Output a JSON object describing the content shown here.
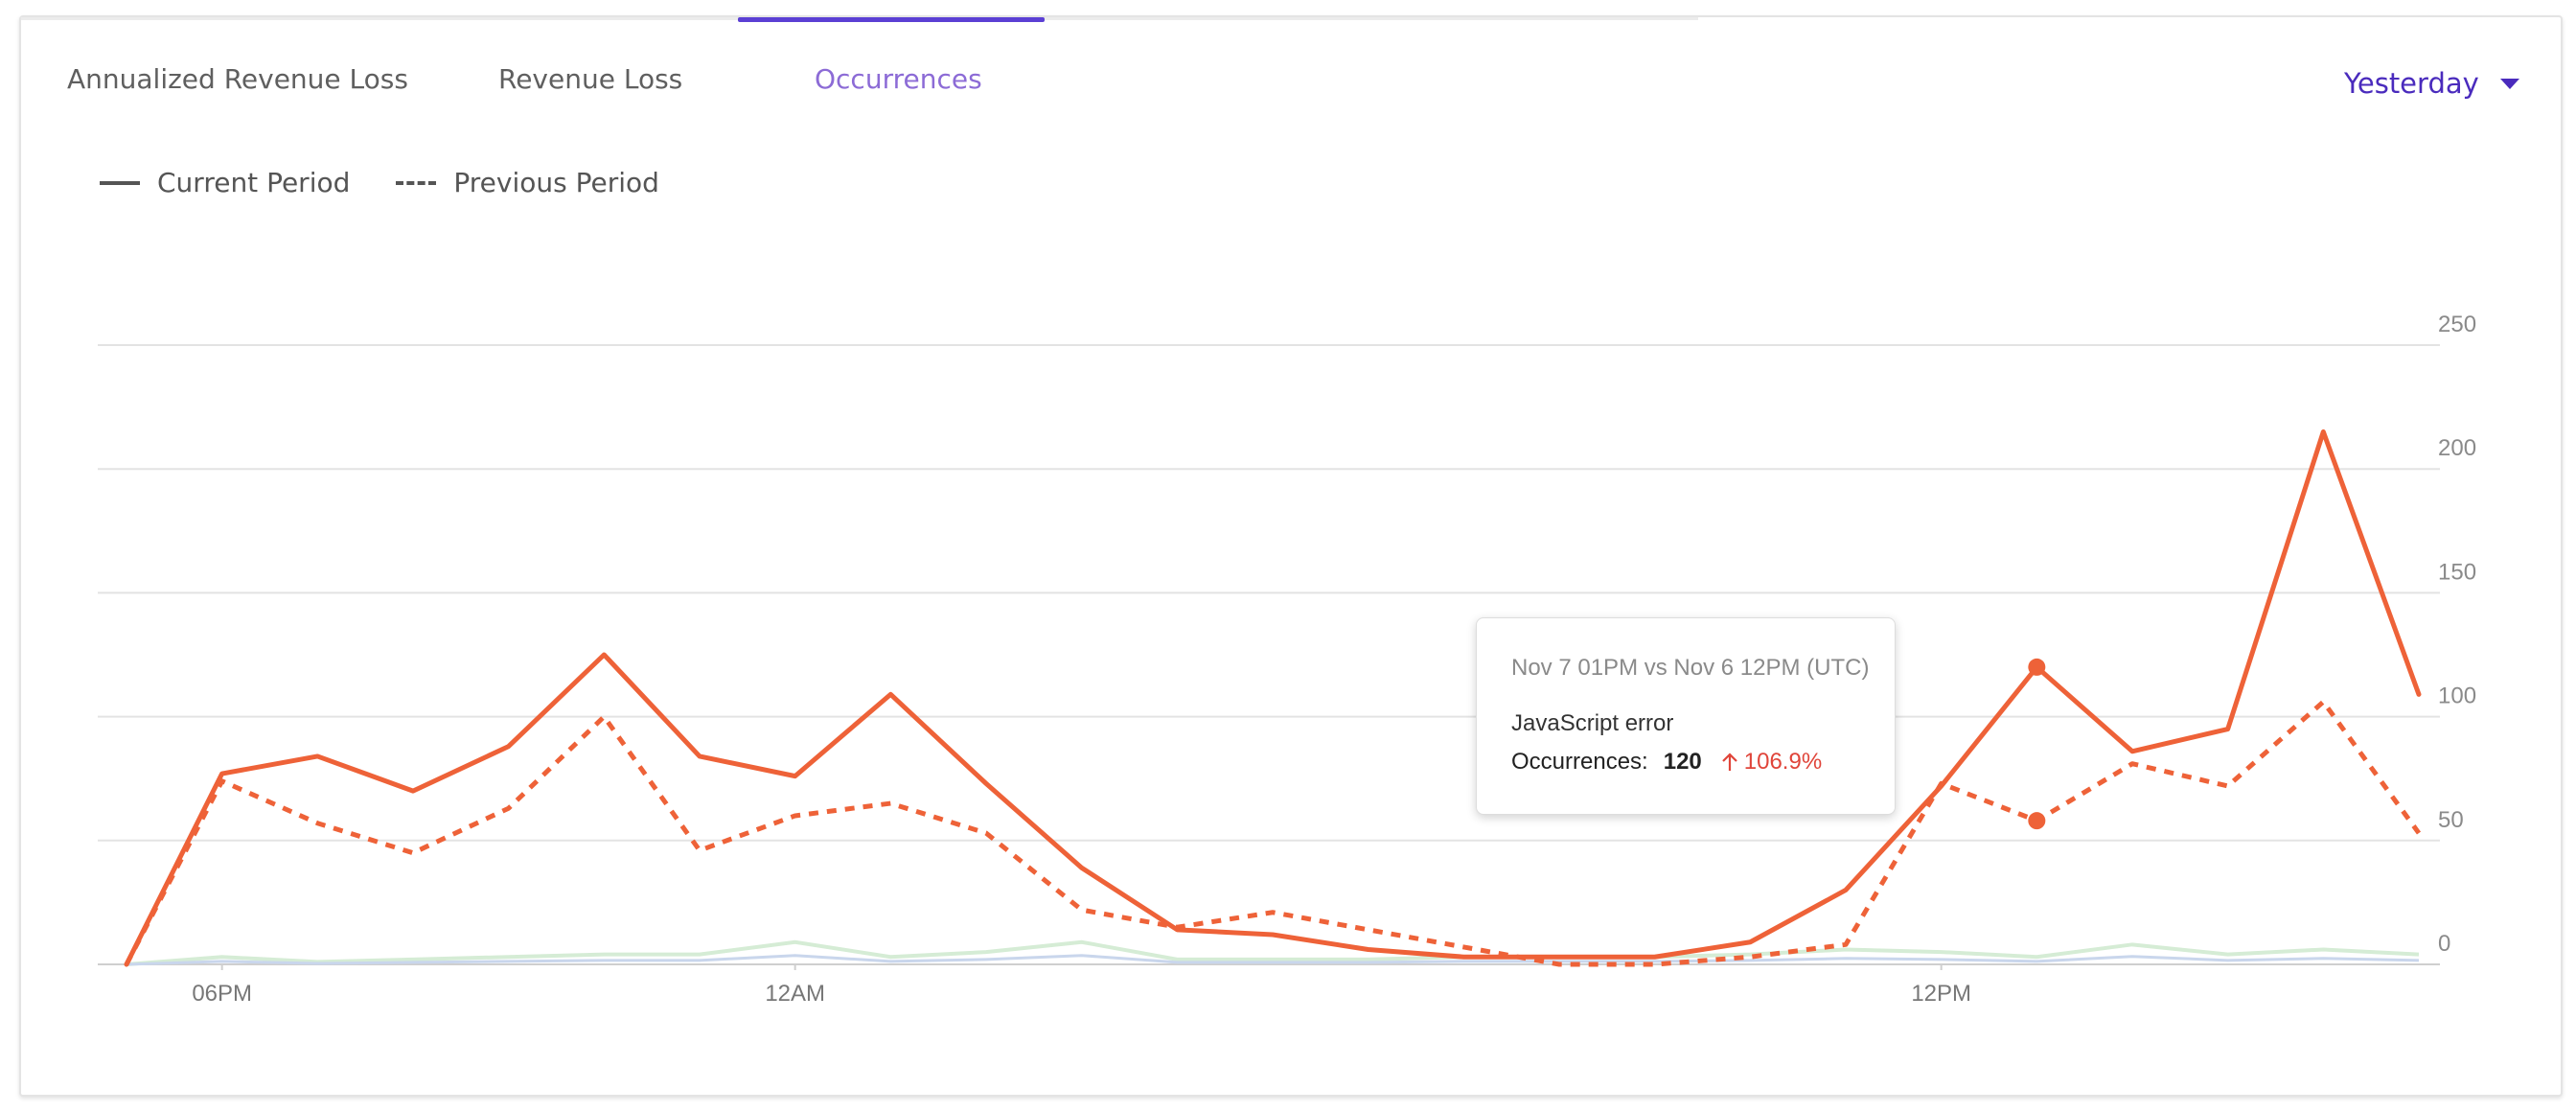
{
  "tabs": [
    {
      "label": "Annualized Revenue Loss",
      "active": false
    },
    {
      "label": "Revenue Loss",
      "active": false
    },
    {
      "label": "Occurrences",
      "active": true
    }
  ],
  "period_select": {
    "value": "Yesterday"
  },
  "legend": {
    "current": "Current Period",
    "previous": "Previous Period"
  },
  "colors": {
    "line": "#ee6238",
    "grid": "#e3e3e3",
    "accent": "#5b3fd4"
  },
  "tooltip": {
    "header": "Nov 7 01PM vs Nov 6 12PM (UTC)",
    "series": "JavaScript error",
    "metric_label": "Occurrences:",
    "metric_value": "120",
    "change": "106.9%",
    "change_icon": "arrow-up-icon"
  },
  "chart_data": {
    "type": "line",
    "x": [
      "05PM",
      "06PM",
      "07PM",
      "08PM",
      "09PM",
      "10PM",
      "11PM",
      "12AM",
      "01AM",
      "02AM",
      "03AM",
      "04AM",
      "05AM",
      "06AM",
      "07AM",
      "08AM",
      "09AM",
      "10AM",
      "11AM",
      "12PM",
      "01PM",
      "02PM",
      "03PM",
      "04PM",
      "05PM"
    ],
    "x_tick_labels": [
      "06PM",
      "12AM",
      "12PM"
    ],
    "y_tick_labels": [
      "0",
      "50",
      "100",
      "150",
      "200",
      "250"
    ],
    "ylim": [
      0,
      250
    ],
    "y_axis_position": "right",
    "grid": true,
    "legend_position": "top-left",
    "series": [
      {
        "name": "Current Period",
        "style": "solid",
        "values": [
          0,
          77,
          84,
          70,
          88,
          125,
          84,
          76,
          109,
          73,
          39,
          14,
          12,
          6,
          3,
          3,
          3,
          9,
          30,
          72,
          120,
          86,
          95,
          215,
          109
        ]
      },
      {
        "name": "Previous Period",
        "style": "dashed",
        "values": [
          0,
          74,
          57,
          45,
          63,
          100,
          46,
          60,
          65,
          53,
          22,
          15,
          21,
          14,
          7,
          0,
          0,
          3,
          8,
          73,
          58,
          81,
          72,
          106,
          53
        ]
      }
    ],
    "highlight_index": 20
  }
}
